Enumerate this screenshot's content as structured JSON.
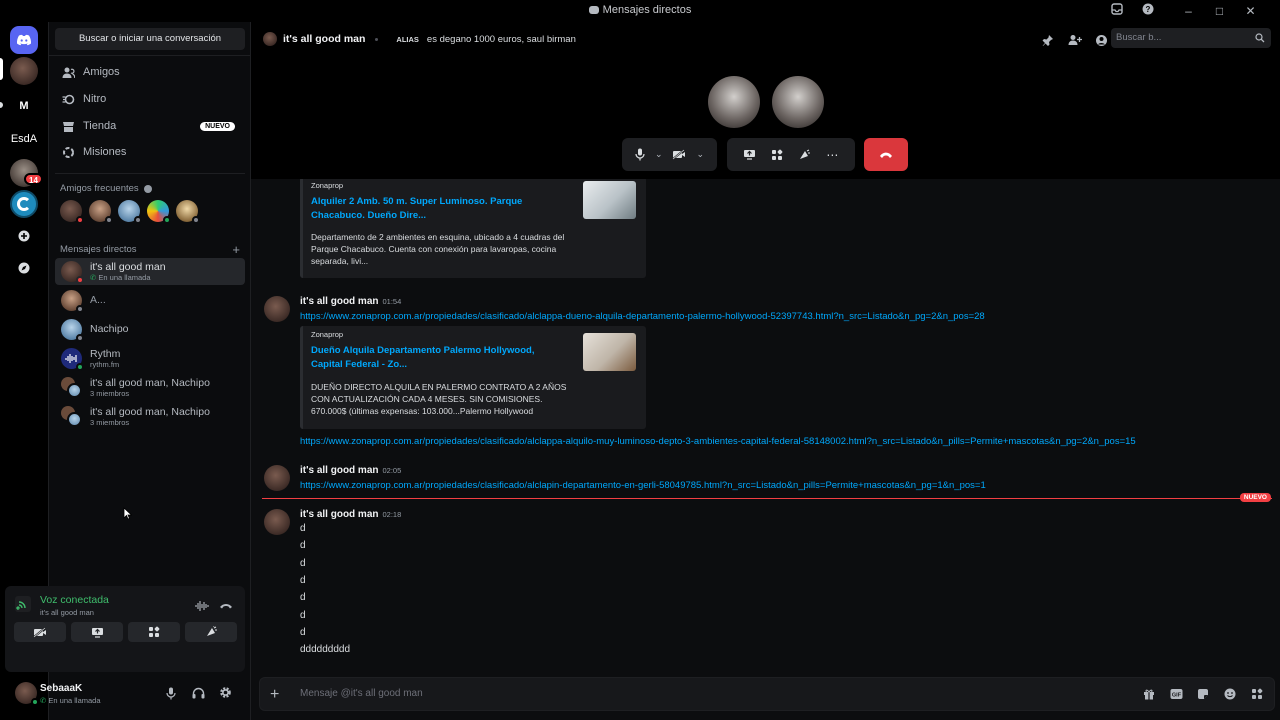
{
  "window": {
    "title": "Mensajes directos"
  },
  "guilds": [
    {
      "label": "M"
    },
    {
      "label": "EsdA"
    },
    {
      "badge": "14"
    }
  ],
  "sidebar": {
    "search": "Buscar o iniciar una conversación",
    "nav": [
      {
        "label": "Amigos",
        "icon": "friends-icon"
      },
      {
        "label": "Nitro",
        "icon": "nitro-icon"
      },
      {
        "label": "Tienda",
        "icon": "shop-icon",
        "badge": "NUEVO"
      },
      {
        "label": "Misiones",
        "icon": "quests-icon"
      }
    ],
    "frequent_header": "Amigos frecuentes",
    "dm_header": "Mensajes directos",
    "dms": [
      {
        "name": "it's all good man",
        "sub": "En una llamada"
      },
      {
        "name": "A...",
        "sub": ""
      },
      {
        "name": "Nachipo",
        "sub": ""
      },
      {
        "name": "Rythm",
        "sub": "rythm.fm"
      },
      {
        "name": "it's all good man, Nachipo",
        "sub": "3 miembros"
      },
      {
        "name": "it's all good man, Nachipo",
        "sub": "3 miembros"
      }
    ]
  },
  "voice": {
    "status": "Voz conectada",
    "channel": "it's all good man"
  },
  "user": {
    "name": "SebaaaK",
    "status": "En una llamada"
  },
  "header": {
    "channel_name": "it's all good man",
    "alias_label": "ALIAS",
    "alias_value": "es degano 1000 euros, saul birman",
    "search_placeholder": "Buscar b..."
  },
  "messages": {
    "embed1": {
      "provider": "Zonaprop",
      "title": "Alquiler 2 Amb. 50 m. Super Luminoso. Parque Chacabuco. Dueño Dire...",
      "description": "Departamento de 2 ambientes en esquina, ubicado a 4 cuadras del Parque Chacabuco. Cuenta con conexión para lavaropas, cocina separada, livi..."
    },
    "msg1": {
      "author": "it's all good man",
      "time": "01:54",
      "link": "https://www.zonaprop.com.ar/propiedades/clasificado/alclappa-dueno-alquila-departamento-palermo-hollywood-52397743.html?n_src=Listado&n_pg=2&n_pos=28"
    },
    "embed2": {
      "provider": "Zonaprop",
      "title": "Dueño Alquila Departamento Palermo Hollywood, Capital Federal - Zo...",
      "description": "DUEÑO DIRECTO ALQUILA EN PALERMO CONTRATO A 2 AÑOS CON ACTUALIZACIÓN CADA 4 MESES. SIN COMISIONES. 670.000$ (últimas expensas: 103.000...Palermo Hollywood"
    },
    "link2": "https://www.zonaprop.com.ar/propiedades/clasificado/alclappa-alquilo-muy-luminoso-depto-3-ambientes-capital-federal-58148002.html?n_src=Listado&n_pills=Permite+mascotas&n_pg=2&n_pos=15",
    "msg2": {
      "author": "it's all good man",
      "time": "02:05",
      "link": "https://www.zonaprop.com.ar/propiedades/clasificado/alclapin-departamento-en-gerli-58049785.html?n_src=Listado&n_pills=Permite+mascotas&n_pg=1&n_pos=1"
    },
    "new_label": "NUEVO",
    "msg3": {
      "author": "it's all good man",
      "time": "02:18",
      "lines": [
        "d",
        "d",
        "d",
        "d",
        "d",
        "d",
        "d",
        "ddddddddd"
      ]
    }
  },
  "composer": {
    "placeholder": "Mensaje @it's all good man"
  },
  "colors": {
    "accent": "#5865f2",
    "online": "#23a55a",
    "danger": "#da373c",
    "link": "#00a8fc"
  }
}
